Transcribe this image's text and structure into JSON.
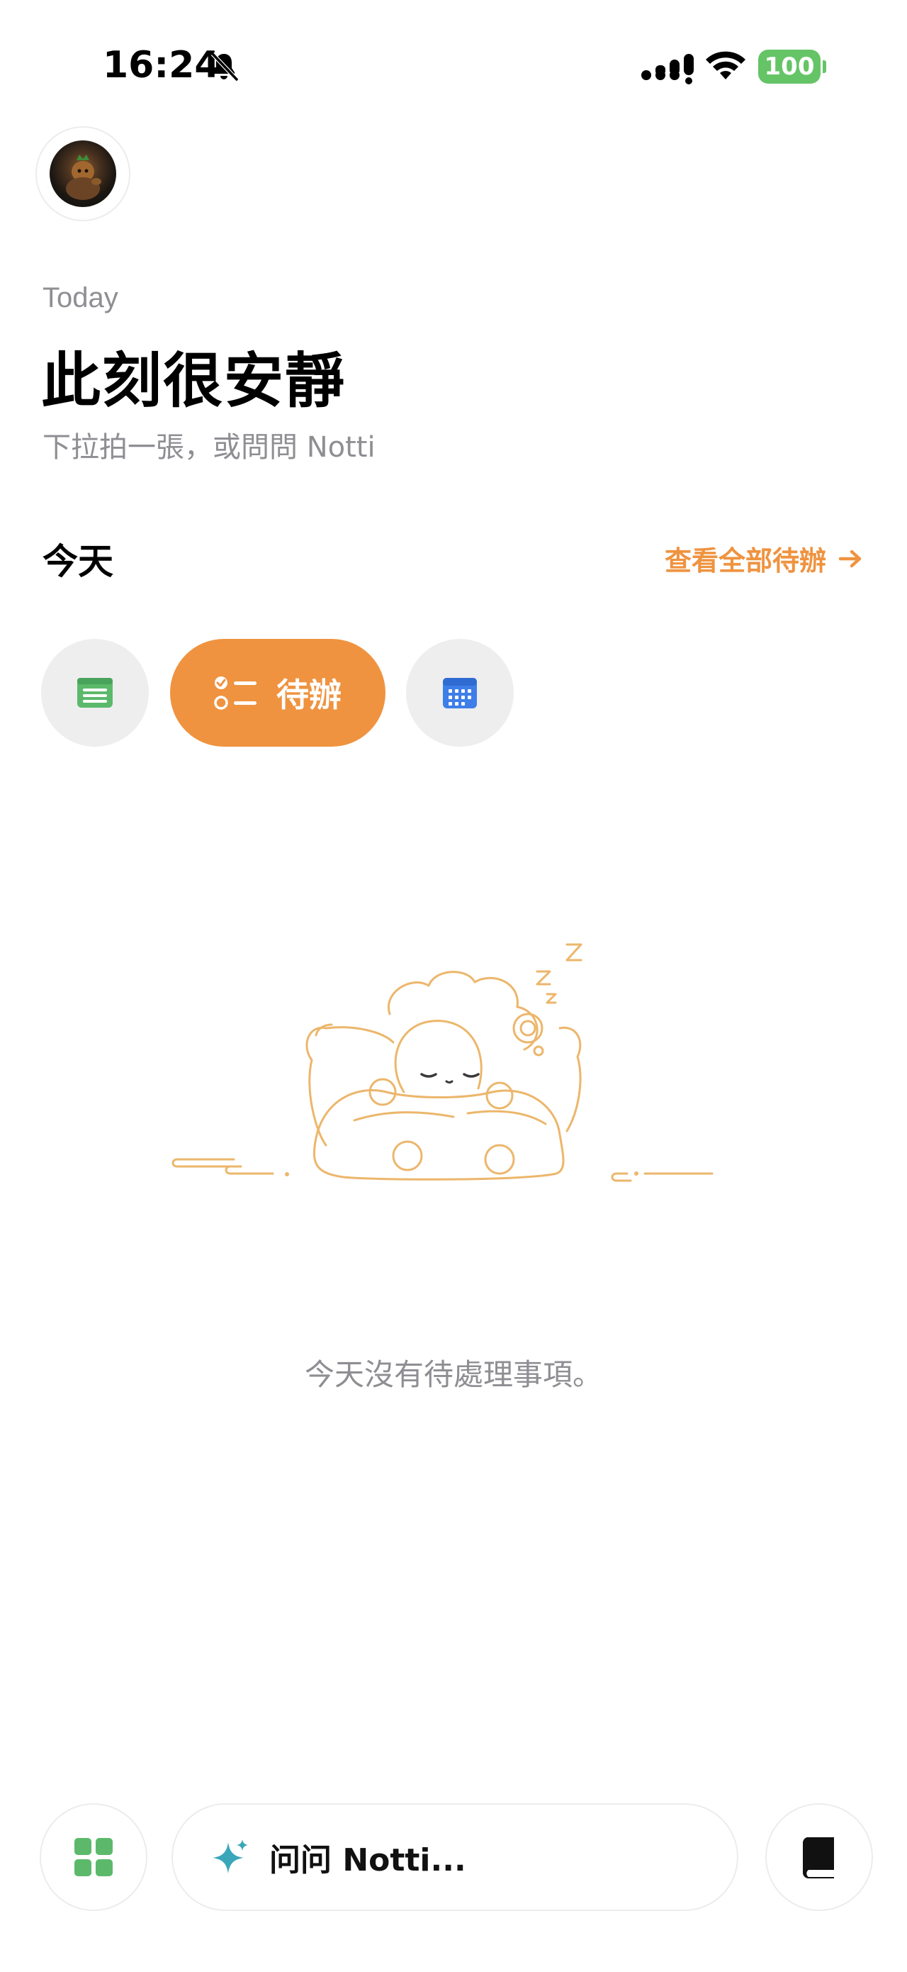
{
  "status_bar": {
    "time": "16:24",
    "battery": "100",
    "icons": [
      "bell-slash-icon",
      "cellular-signal-icon",
      "wifi-icon",
      "battery-icon"
    ],
    "battery_color": "#65c466"
  },
  "header": {
    "eyebrow": "Today",
    "title": "此刻很安靜",
    "subtitle": "下拉拍一張，或問問 Notti"
  },
  "section": {
    "title": "今天",
    "view_all_label": "查看全部待辦",
    "view_all_icon": "arrow-right-icon"
  },
  "filters": [
    {
      "icon": "notes-icon",
      "icon_color": "#5cb96b",
      "label": "",
      "selected": false
    },
    {
      "icon": "checklist-icon",
      "icon_color": "#ffffff",
      "label": "待辦",
      "selected": true
    },
    {
      "icon": "calendar-icon",
      "icon_color": "#3e7ee8",
      "label": "",
      "selected": false
    }
  ],
  "empty_state": {
    "illustration": "sleeping-character-illustration",
    "message": "今天沒有待處理事項。"
  },
  "bottom_bar": {
    "apps_icon": "grid-icon",
    "ask_placeholder": "问问 Notti...",
    "ask_icon": "sparkle-icon",
    "book_icon": "book-icon"
  },
  "colors": {
    "accent": "#ef9340",
    "muted_text": "#8e8e93",
    "chip_bg": "#eeeeef",
    "grid_green": "#5cb96b",
    "sparkle_teal": "#3aa6b9"
  }
}
